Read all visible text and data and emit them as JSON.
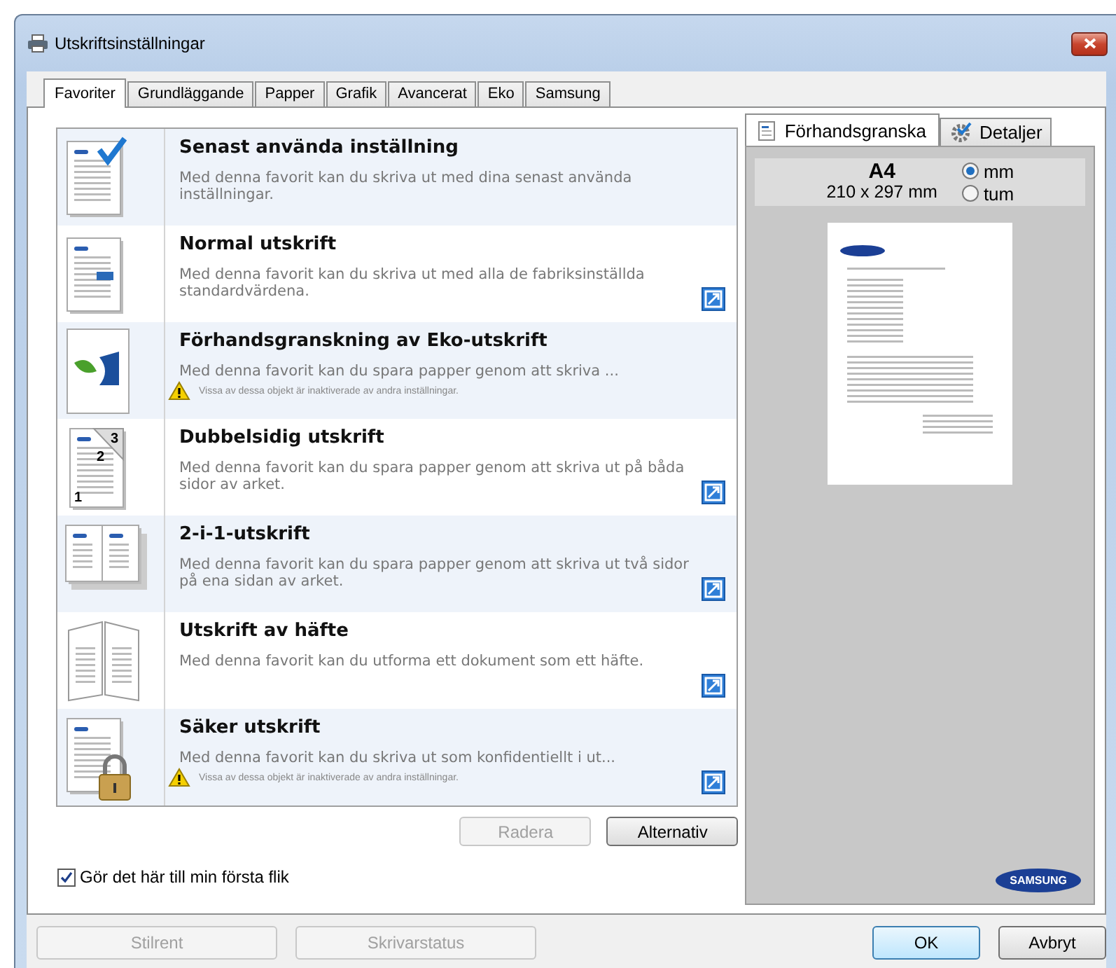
{
  "window": {
    "title": "Utskriftsinställningar"
  },
  "tabs": [
    {
      "label": "Favoriter",
      "selected": true
    },
    {
      "label": "Grundläggande",
      "selected": false
    },
    {
      "label": "Papper",
      "selected": false
    },
    {
      "label": "Grafik",
      "selected": false
    },
    {
      "label": "Avancerat",
      "selected": false
    },
    {
      "label": "Eko",
      "selected": false
    },
    {
      "label": "Samsung",
      "selected": false
    }
  ],
  "favorites": [
    {
      "kind": "last-used",
      "title": "Senast använda inställning",
      "description": "Med denna favorit kan du skriva ut med dina senast använda inställningar.",
      "shortcut": false
    },
    {
      "kind": "normal",
      "title": "Normal utskrift",
      "description": "Med denna favorit kan du skriva ut med alla de fabriksinställda standardvärdena.",
      "shortcut": true
    },
    {
      "kind": "eco",
      "title": "Förhandsgranskning av Eko-utskrift",
      "description": "Med denna favorit kan du spara papper genom att skriva ...",
      "warning": "Vissa av dessa objekt är inaktiverade av andra inställningar.",
      "shortcut": false
    },
    {
      "kind": "duplex",
      "icon_labels": [
        "3",
        "2",
        "1"
      ],
      "title": "Dubbelsidig utskrift",
      "description": "Med denna favorit kan du spara papper genom att skriva ut på båda sidor av arket.",
      "shortcut": true
    },
    {
      "kind": "two-in-one",
      "title": "2-i-1-utskrift",
      "description": "Med denna favorit kan du spara papper genom att skriva ut två sidor på ena sidan av arket.",
      "shortcut": true
    },
    {
      "kind": "booklet",
      "title": "Utskrift av häfte",
      "description": "Med denna favorit kan du utforma ett dokument som ett häfte.",
      "shortcut": true
    },
    {
      "kind": "secure",
      "title": "Säker utskrift",
      "description": "Med denna favorit kan du skriva ut som konfidentiellt i ut...",
      "warning": "Vissa av dessa objekt är inaktiverade av andra inställningar.",
      "shortcut": true
    }
  ],
  "list_buttons": [
    {
      "label": "Radera",
      "disabled": true
    },
    {
      "label": "Alternativ",
      "disabled": false
    }
  ],
  "first_tab_checkbox": {
    "label": "Gör det här till min första flik",
    "checked": true
  },
  "preview_tabs": [
    {
      "kind": "preview",
      "label": "Förhandsgranska",
      "selected": true
    },
    {
      "kind": "details",
      "label": "Detaljer",
      "selected": false
    }
  ],
  "paper": {
    "size": "A4",
    "dimensions": "210 x 297 mm"
  },
  "units": [
    {
      "label": "mm",
      "selected": true
    },
    {
      "label": "tum",
      "selected": false
    }
  ],
  "logo": "SAMSUNG",
  "footer_buttons": [
    {
      "label": "Stilrent",
      "disabled": true,
      "default": false
    },
    {
      "label": "Skrivarstatus",
      "disabled": true,
      "default": false
    },
    {
      "label": "OK",
      "disabled": false,
      "default": true
    },
    {
      "label": "Avbryt",
      "disabled": false,
      "default": false
    }
  ]
}
